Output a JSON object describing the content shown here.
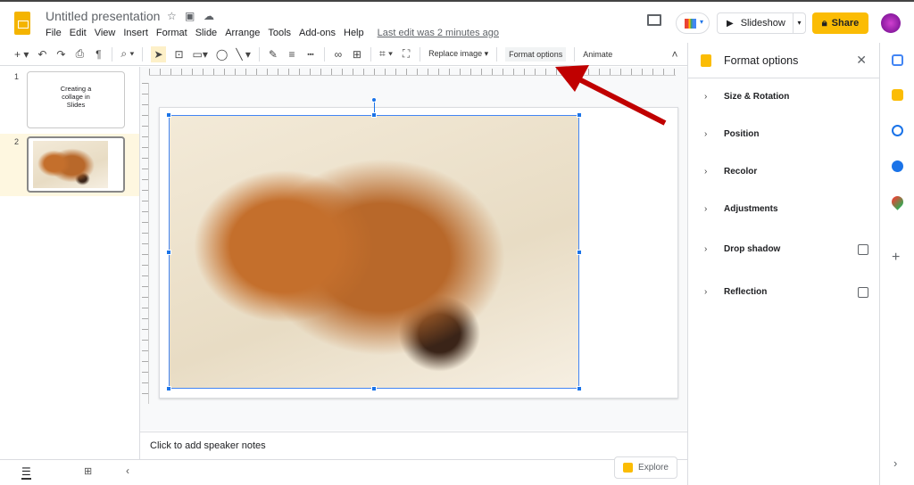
{
  "app": {
    "title": "Untitled presentation",
    "last_edit": "Last edit was 2 minutes ago"
  },
  "menu": [
    "File",
    "Edit",
    "View",
    "Insert",
    "Format",
    "Slide",
    "Arrange",
    "Tools",
    "Add-ons",
    "Help"
  ],
  "header": {
    "slideshow": "Slideshow",
    "share": "Share"
  },
  "toolbar": {
    "replace_image": "Replace image",
    "format_options": "Format options",
    "animate": "Animate"
  },
  "slides": [
    {
      "number": "1",
      "text": "Creating a collage in Slides"
    },
    {
      "number": "2"
    }
  ],
  "notes": {
    "placeholder": "Click to add speaker notes"
  },
  "explore": "Explore",
  "format_panel": {
    "title": "Format options",
    "sections": [
      {
        "label": "Size & Rotation",
        "checkbox": false
      },
      {
        "label": "Position",
        "checkbox": false
      },
      {
        "label": "Recolor",
        "checkbox": false
      },
      {
        "label": "Adjustments",
        "checkbox": false
      },
      {
        "label": "Drop shadow",
        "checkbox": true,
        "checked": false
      },
      {
        "label": "Reflection",
        "checkbox": true,
        "checked": false
      }
    ]
  },
  "colors": {
    "accent": "#fbbc04",
    "selection": "#1a73e8",
    "arrow": "#c00000"
  }
}
